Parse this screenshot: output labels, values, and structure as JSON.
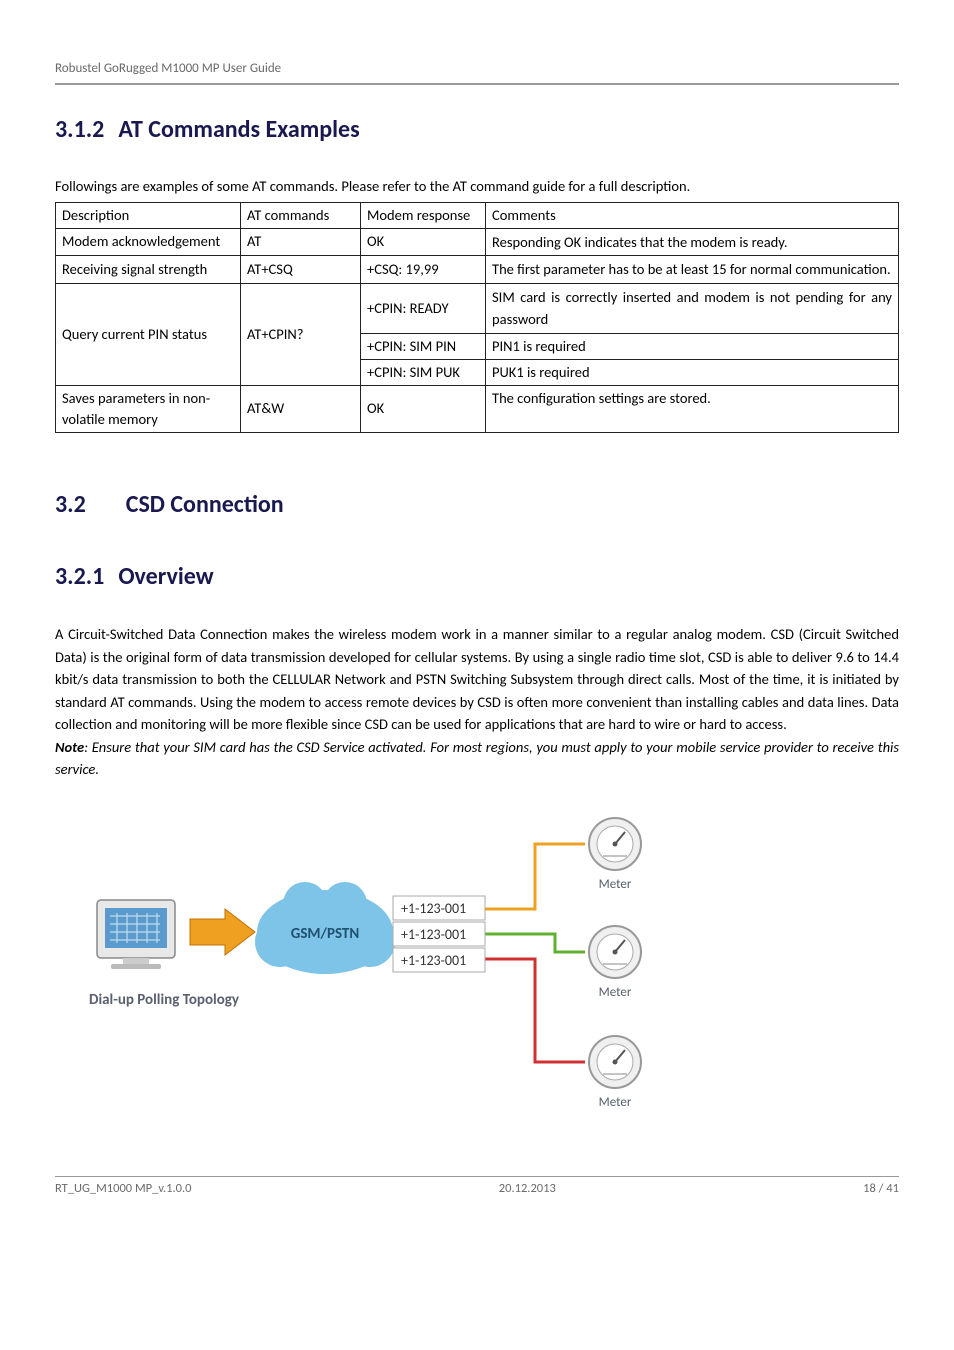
{
  "header": {
    "title": "Robustel GoRugged M1000 MP User Guide"
  },
  "section_312": {
    "number": "3.1.2",
    "title": "AT Commands Examples",
    "intro": "Followings are examples of some AT commands. Please refer to the AT command guide for a full description.",
    "table": {
      "headers": {
        "description": "Description",
        "atcmd": "AT commands",
        "response": "Modem response",
        "comments": "Comments"
      },
      "rows": [
        {
          "description": "Modem acknowledgement",
          "atcmd": "AT",
          "response": "OK",
          "comments": "Responding OK indicates that the modem is ready."
        },
        {
          "description": "Receiving signal strength",
          "atcmd": "AT+CSQ",
          "response": "+CSQ: 19,99",
          "comments": "The first parameter has to be at least 15 for normal communication."
        },
        {
          "description": "Query current PIN status",
          "atcmd": "AT+CPIN?",
          "responses": [
            {
              "response": "+CPIN: READY",
              "comments": "SIM card is correctly inserted and modem is not pending for any password"
            },
            {
              "response": "+CPIN: SIM PIN",
              "comments": "PIN1 is required"
            },
            {
              "response": "+CPIN: SIM PUK",
              "comments": "PUK1 is required"
            }
          ]
        },
        {
          "description": "Saves parameters in non-volatile memory",
          "atcmd": "AT&W",
          "response": "OK",
          "comments": "The configuration settings are stored."
        }
      ]
    }
  },
  "section_32": {
    "number": "3.2",
    "title": "CSD Connection"
  },
  "section_321": {
    "number": "3.2.1",
    "title": "Overview",
    "body": "A Circuit-Switched Data Connection makes the wireless modem work in a manner similar to a regular analog modem. CSD (Circuit Switched Data) is the original form of data transmission developed for cellular systems. By using a single radio time slot, CSD is able to deliver 9.6 to 14.4 kbit/s data transmission to both the CELLULAR Network and PSTN Switching Subsystem through direct calls. Most of the time, it is initiated by standard AT commands. Using the modem to access remote devices by CSD is often more convenient than installing cables and data lines. Data collection and monitoring will be more flexible since CSD can be used for applications that are hard to wire or hard to access.",
    "note_label": "Note",
    "note": ": Ensure that your SIM card has the CSD Service activated. For most regions, you must apply to your mobile service provider to receive this service."
  },
  "diagram": {
    "dial_label": "Dial-up Polling Topology",
    "cloud_label": "GSM/PSTN",
    "phone_numbers": [
      "+1-123-001",
      "+1-123-001",
      "+1-123-001"
    ],
    "meter_label": "Meter"
  },
  "footer": {
    "left": "RT_UG_M1000 MP_v.1.0.0",
    "center": "20.12.2013",
    "right": "18 / 41"
  }
}
